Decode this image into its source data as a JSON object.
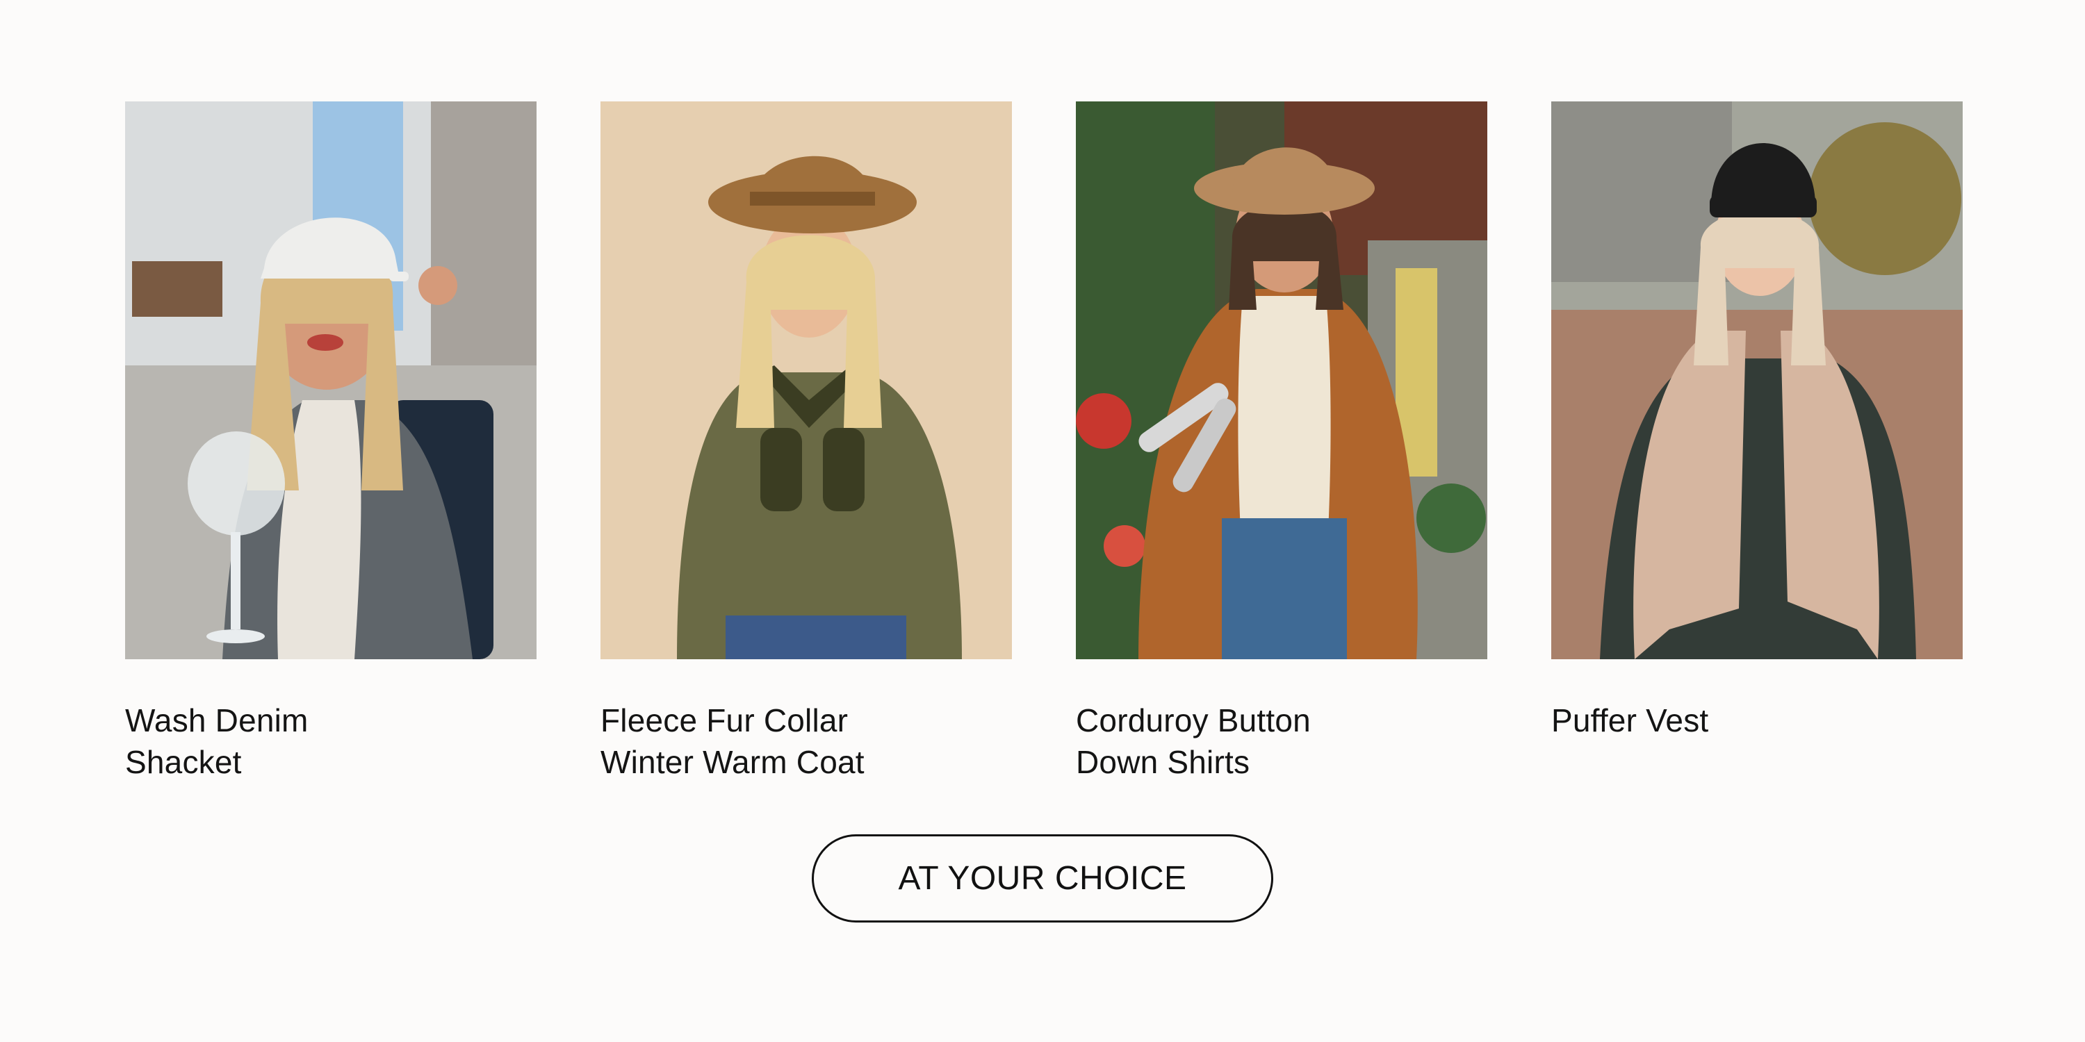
{
  "products": [
    {
      "title": "Wash Denim\nShacket",
      "image_alt": "Woman in gray acid-wash denim shacket and white cap holding a glass",
      "colors": {
        "background": "#9fb0bd",
        "garment": "#5b6166",
        "accent": "#e8e8e6"
      }
    },
    {
      "title": "Fleece Fur Collar\nWinter Warm Coat",
      "image_alt": "Woman in olive corduroy coat with fleece collar and tan wide-brim hat",
      "colors": {
        "background": "#e6cfb0",
        "garment": "#6a6a45",
        "accent": "#a0703c"
      }
    },
    {
      "title": "Corduroy Button\nDown Shirts",
      "image_alt": "Woman in rust corduroy button-down shirt, cream sweater and tan hat",
      "colors": {
        "background": "#4a4f36",
        "garment": "#b0652c",
        "accent": "#efe6d4"
      }
    },
    {
      "title": "Puffer Vest",
      "image_alt": "Woman in tan puffer vest over dark green shirt and black beanie",
      "colors": {
        "background": "#b99a82",
        "garment": "#d6b6a0",
        "accent": "#333c37"
      }
    }
  ],
  "cta": {
    "label": "AT YOUR CHOICE"
  }
}
